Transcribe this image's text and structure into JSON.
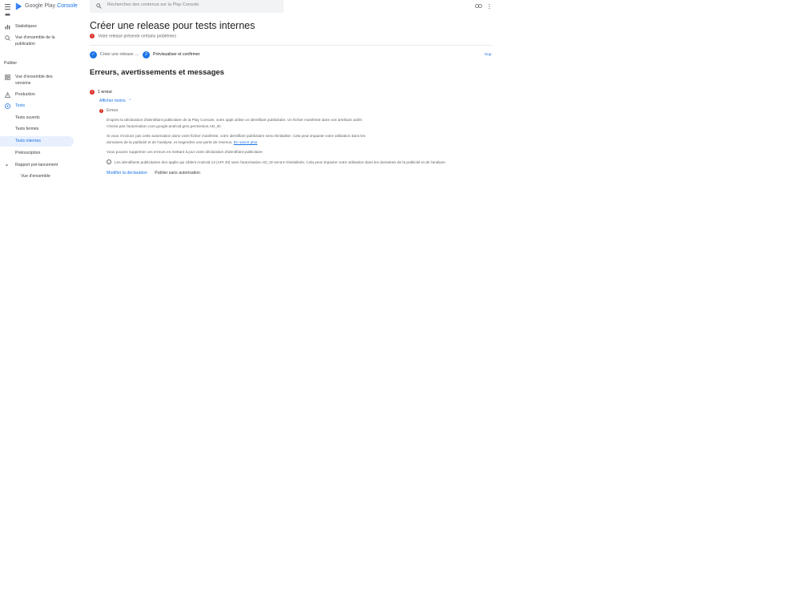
{
  "app": {
    "brand_name": "Google Play",
    "brand_suffix": "Console"
  },
  "search": {
    "placeholder": "Recherchez des contenus sur la Play Console"
  },
  "sidebar": {
    "items_top": [
      {
        "label": "Statistiques",
        "icon": "bar-chart-icon"
      },
      {
        "label": "Vue d'ensemble de la publication",
        "icon": "publishing-overview-icon"
      }
    ],
    "section_publish": "Publier",
    "items_publish": [
      {
        "label": "Vue d'ensemble des versions",
        "icon": "grid-icon"
      },
      {
        "label": "Production",
        "icon": "warning-triangle-icon"
      },
      {
        "label": "Tests",
        "icon": "play-circle-icon"
      },
      {
        "label": "Tests ouverts"
      },
      {
        "label": "Tests fermés"
      },
      {
        "label": "Tests internes",
        "active": true
      },
      {
        "label": "Préinscription"
      },
      {
        "label": "Rapport pré-lancement",
        "icon": "caret-down-icon"
      },
      {
        "label": "Vue d'ensemble"
      }
    ]
  },
  "main": {
    "title": "Créer une release pour tests internes",
    "status_message": "Votre release présente certains problèmes",
    "steps": [
      {
        "label": "Créer une release",
        "state": "done"
      },
      {
        "label": "Prévisualiser et confirmer",
        "number": "2",
        "state": "current"
      }
    ],
    "steps_link": "Sup",
    "section_title": "Erreurs, avertissements et messages",
    "error_count": "1 erreur",
    "toggle_label": "Afficher moins",
    "error_label": "Erreur",
    "paragraph1": "D'après la déclaration d'identifiant publicitaire de la Play Console, votre appli utilise un identifiant publicitaire. Un fichier manifeste dans vos artefacts actifs n'inclut pas l'autorisation com.google.android.gms.permission.AD_ID.",
    "paragraph2_text": "Si vous n'incluez pas cette autorisation dans votre fichier manifeste, votre identifiant publicitaire sera réinitialisé. Cela peut impacter votre utilisation dans les domaines de la publicité et de l'analyse, et engendrer une perte de revenus.",
    "paragraph2_link": "En savoir plus",
    "paragraph3": "Vous pouvez supprimer ces erreurs en mettant à jour votre déclaration d'identifiant publicitaire",
    "info_text": "Les identifiants publicitaires des applis qui ciblent Android 13 (API 33) sans l'autorisation AD_ID seront réinitialisés. Cela peut impacter votre utilisation dans les domaines de la publicité et de l'analyse.",
    "action_primary": "Modifier la déclaration",
    "action_secondary": "Publier sans autorisation"
  },
  "colors": {
    "accent": "#1a73e8",
    "error": "#d93025",
    "active_nav_bg": "#e8f0fe"
  }
}
